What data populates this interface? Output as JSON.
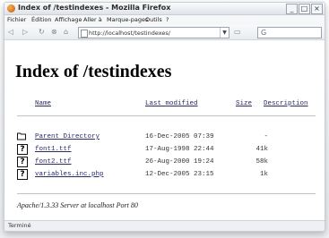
{
  "window": {
    "title": "Index of /testindexes - Mozilla Firefox",
    "controls": [
      "_",
      "□",
      "×"
    ]
  },
  "menu": {
    "items": [
      "Fichier",
      "Édition",
      "Affichage",
      "Aller à",
      "Marque-pages",
      "Outils",
      "?"
    ]
  },
  "toolbar": {
    "back_icon": "◁",
    "forward_icon": "▷",
    "reload_icon": "↻",
    "stop_icon": "⊗",
    "home_icon": "⌂",
    "address_value": "http://localhost/testindexes/",
    "dropdown_icon": "▼",
    "go_icon": "▭",
    "search_icon": "G"
  },
  "page": {
    "title": "Index of /testindexes",
    "columns": {
      "name": "Name",
      "modified": "Last modified",
      "size": "Size",
      "description": "Description"
    },
    "rows": [
      {
        "icon": "folder",
        "name": "Parent Directory",
        "modified": "16-Dec-2005 07:39",
        "size": "-"
      },
      {
        "icon": "unknown",
        "name": "font1.ttf",
        "modified": "17-Aug-1998 22:44",
        "size": "41k"
      },
      {
        "icon": "unknown",
        "name": "font2.ttf",
        "modified": "26-Aug-2000 19:24",
        "size": "58k"
      },
      {
        "icon": "unknown",
        "name": "variables.inc.php",
        "modified": "12-Dec-2005 23:15",
        "size": "1k"
      }
    ],
    "footer": "Apache/1.3.33 Server at localhost Port 80"
  },
  "status": {
    "text": "Terminé"
  }
}
